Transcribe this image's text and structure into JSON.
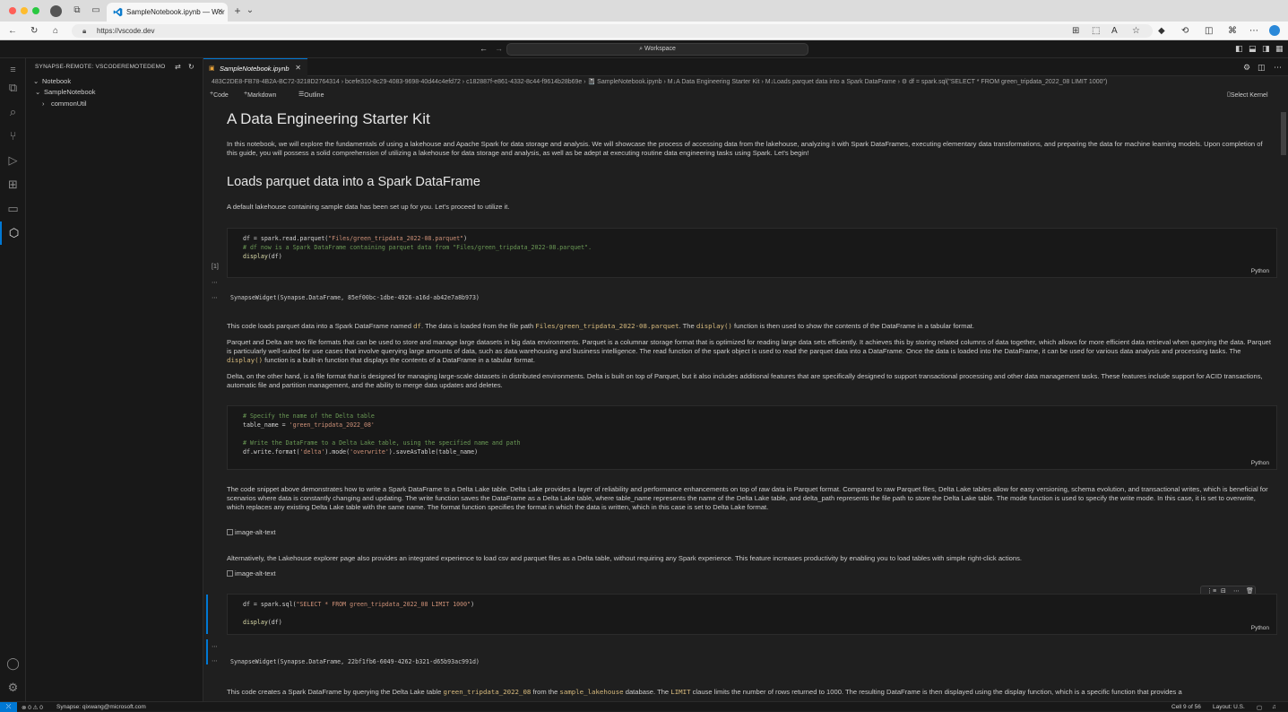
{
  "browser": {
    "tab_title": "SampleNotebook.ipynb — Wor",
    "url": "https://vscode.dev"
  },
  "titlebar": {
    "search_label": "Workspace"
  },
  "sidebar": {
    "title": "SYNAPSE-REMOTE: VSCODEREMOTEDEMO",
    "items": [
      {
        "label": "Notebook",
        "chevron": "⌄"
      },
      {
        "label": "SampleNotebook",
        "chevron": "⌄"
      },
      {
        "label": "commonUtil",
        "chevron": "›"
      }
    ]
  },
  "editor": {
    "tab_label": "SampleNotebook.ipynb",
    "breadcrumb": "483C2DE8-FB78-4B2A-BC72-3218D2764314 › bcefe310-8c29-4083-9698-40d44c4efd72 › c182887f-e861-4332-8c44-f9614b28b69e › 📓 SampleNotebook.ipynb › M↓A Data Engineering Starter Kit › M↓Loads parquet data into a Spark DataFrame › ⚙ df = spark.sql(\"SELECT * FROM green_tripdata_2022_08 LIMIT 1000\")",
    "toolbar": {
      "code": "Code",
      "markdown": "Markdown",
      "outline": "Outline",
      "kernel": "Select Kernel"
    }
  },
  "notebook": {
    "h1": "A Data Engineering Starter Kit",
    "intro": "In this notebook, we will explore the fundamentals of using a lakehouse and Apache Spark for data storage and analysis. We will showcase the process of accessing data from the lakehouse, analyzing it with Spark DataFrames, executing elementary data transformations, and preparing the data for machine learning models. Upon completion of this guide, you will possess a solid comprehension of utilizing a lakehouse for data storage and analysis, as well as be adept at executing routine data engineering tasks using Spark. Let's begin!",
    "h2": "Loads parquet data into a Spark DataFrame",
    "p_default": "A default lakehouse containing sample data has been set up for you. Let's proceed to utilize it.",
    "cell1": {
      "exec_count": "[1]",
      "line1_a": "df = spark.read.parquet(",
      "line1_str": "\"Files/green_tripdata_2022-08.parquet\"",
      "line1_b": ")",
      "line2": "# df now is a Spark DataFrame containing parquet data from \"Files/green_tripdata_2022-08.parquet\".",
      "line3_fn": "display",
      "line3_b": "(df)",
      "lang": "Python",
      "output": "SynapseWidget(Synapse.DataFrame, 85ef00bc-1dbe-4926-a16d-ab42e7a8b973)"
    },
    "p_loads_1": "This code loads parquet data into a Spark DataFrame named ",
    "p_loads_df": "df",
    "p_loads_2": ". The data is loaded from the file path ",
    "p_loads_path": "Files/green_tripdata_2022-08.parquet",
    "p_loads_3": ". The ",
    "p_loads_display": "display()",
    "p_loads_4": " function is then used to show the contents of the DataFrame in a tabular format.",
    "p_parquet_1": "Parquet and Delta are two file formats that can be used to store and manage large datasets in big data environments. Parquet is a columnar storage format that is optimized for reading large data sets efficiently. It achieves this by storing related columns of data together, which allows for more efficient data retrieval when querying the data. Parquet is particularly well-suited for use cases that involve querying large amounts of data, such as data warehousing and business intelligence. The read function of the spark object is used to read the parquet data into a DataFrame. Once the data is loaded into the DataFrame, it can be used for various data analysis and processing tasks. The ",
    "p_parquet_display": "display()",
    "p_parquet_2": " function is a built-in function that displays the contents of a DataFrame in a tabular format.",
    "p_delta": "Delta, on the other hand, is a file format that is designed for managing large-scale datasets in distributed environments. Delta is built on top of Parquet, but it also includes additional features that are specifically designed to support transactional processing and other data management tasks. These features include support for ACID transactions, automatic file and partition management, and the ability to merge data updates and deletes.",
    "cell2": {
      "line1": "# Specify the name of the Delta table",
      "line2_a": "table_name = ",
      "line2_str": "'green_tripdata_2022_08'",
      "line3": "# Write the DataFrame to a Delta Lake table, using the specified name and path",
      "line4_a": "df.write.format(",
      "line4_s1": "'delta'",
      "line4_b": ").mode(",
      "line4_s2": "'overwrite'",
      "line4_c": ").saveAsTable(table_name)",
      "lang": "Python"
    },
    "p_snippet": "The code snippet above demonstrates how to write a Spark DataFrame to a Delta Lake table. Delta Lake provides a layer of reliability and performance enhancements on top of raw data in Parquet format. Compared to raw Parquet files, Delta Lake tables allow for easy versioning, schema evolution, and transactional writes, which is beneficial for scenarios where data is constantly changing and updating. The write function saves the DataFrame as a Delta Lake table, where table_name represents the name of the Delta Lake table, and delta_path represents the file path to store the Delta Lake table. The mode function is used to specify the write mode. In this case, it is set to overwrite, which replaces any existing Delta Lake table with the same name. The format function specifies the format in which the data is written, which in this case is set to Delta Lake format.",
    "img_alt_1": "image-alt-text",
    "p_explorer": "Alternatively, the Lakehouse explorer page also provides an integrated experience to load csv and parquet files as a Delta table, without requiring any Spark experience. This feature increases productivity by enabling you to load tables with simple right-click actions.",
    "img_alt_2": "image-alt-text",
    "cell3": {
      "line1_a": "df = spark.sql(",
      "line1_str": "\"SELECT * FROM green_tripdata_2022_08 LIMIT 1000\"",
      "line1_b": ")",
      "line2_fn": "display",
      "line2_b": "(df)",
      "lang": "Python",
      "output": "SynapseWidget(Synapse.DataFrame, 22bf1fb6-6049-4262-b321-d65b93ac991d)"
    },
    "p_creates_1": "This code creates a Spark DataFrame by querying the Delta Lake table ",
    "p_creates_table": "green_tripdata_2022_08",
    "p_creates_2": " from the ",
    "p_creates_db": "sample_lakehouse",
    "p_creates_3": " database. The ",
    "p_creates_limit": "LIMIT",
    "p_creates_4": " clause limits the number of rows returned to 1000. The resulting DataFrame is then displayed using the display function, which is a specific function that provides a"
  },
  "statusbar": {
    "problems": "⊗ 0 ⚠ 0",
    "account": "Synapse: qixwang@microsoft.com",
    "cell": "Cell 9 of 56",
    "layout": "Layout: U.S."
  },
  "colors": {
    "accent": "#0078d4",
    "editor_bg": "#1f1f1f",
    "sidebar_bg": "#181818"
  }
}
